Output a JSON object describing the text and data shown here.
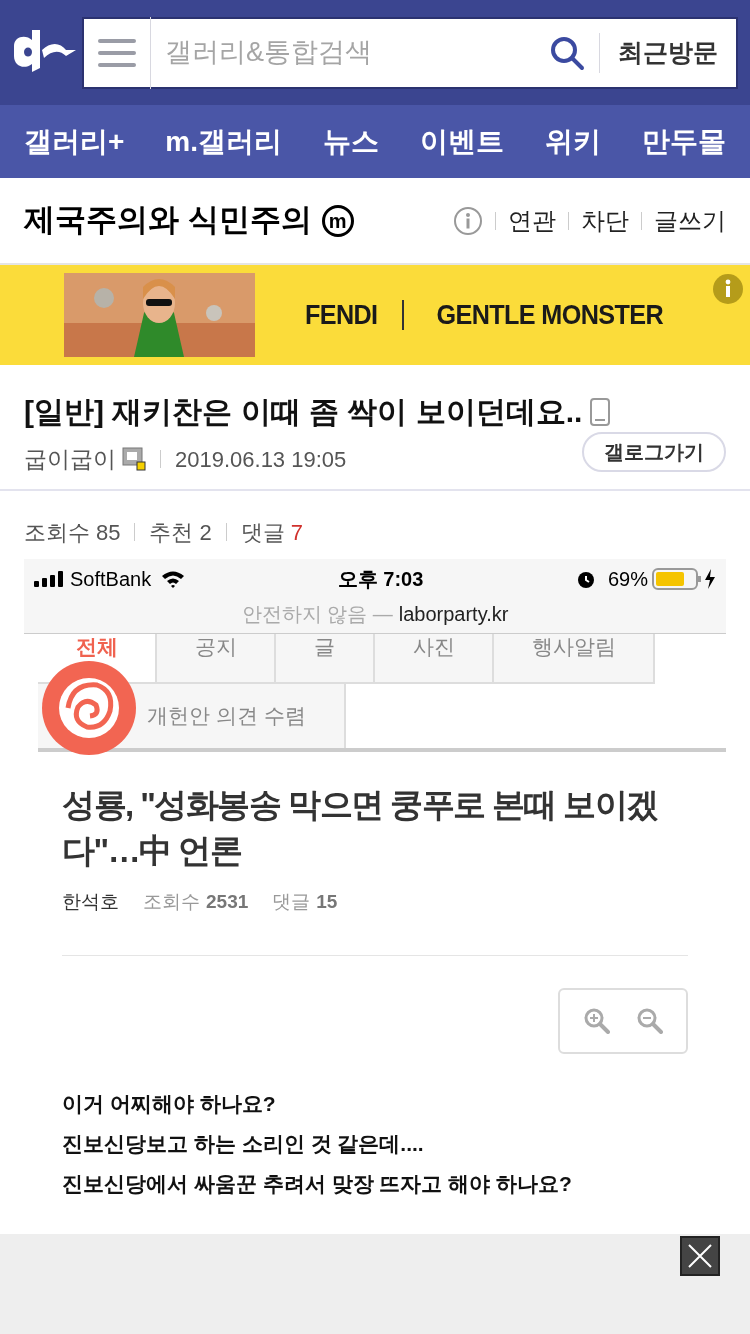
{
  "header": {
    "search": {
      "placeholder": "갤러리&통합검색"
    },
    "recent_button": "최근방문"
  },
  "nav": {
    "items": [
      {
        "label": "갤러리+"
      },
      {
        "label": "m.갤러리"
      },
      {
        "label": "뉴스"
      },
      {
        "label": "이벤트"
      },
      {
        "label": "위키"
      },
      {
        "label": "만두몰"
      }
    ]
  },
  "gallery": {
    "title": "제국주의와 식민주의",
    "badge": "m",
    "actions": [
      "연관",
      "차단",
      "글쓰기"
    ]
  },
  "ad": {
    "brands": [
      "FENDI",
      "GENTLE MONSTER"
    ]
  },
  "post": {
    "title": "[일반] 재키찬은 이때 좀 싹이 보이던데요..",
    "author": "굽이굽이",
    "date": "2019.06.13 19:05",
    "gallog_button": "갤로그가기",
    "stats": [
      {
        "label": "조회수",
        "value": "85",
        "color": "#555555"
      },
      {
        "label": "추천",
        "value": "2",
        "color": "#555555"
      },
      {
        "label": "댓글",
        "value": "7",
        "color": "#d0312d"
      }
    ]
  },
  "screenshot": {
    "status_bar": {
      "carrier": "SoftBank",
      "time": "오후 7:03",
      "battery": "69%"
    },
    "url_bar": {
      "security": "안전하지 않음 —",
      "url": "laborparty.kr"
    },
    "tabs": [
      {
        "label": "전체",
        "selected": true
      },
      {
        "label": "공지",
        "selected": false
      },
      {
        "label": "글",
        "selected": false
      },
      {
        "label": "사진",
        "selected": false
      },
      {
        "label": "행사알림",
        "selected": false
      },
      {
        "label": "개헌안 의견 수렴",
        "selected": false
      }
    ],
    "article": {
      "title": "성룡, \"성화봉송 막으면 쿵푸로 본때 보이겠다\"…中 언론",
      "author": "한석호",
      "views_label": "조회수",
      "views": "2531",
      "comments_label": "댓글",
      "comments": "15",
      "body": [
        "이거 어찌해야 하나요?",
        "진보신당보고 하는 소리인 것 같은데....",
        "진보신당에서 싸움꾼 추려서 맞장 뜨자고 해야 하나요?"
      ]
    }
  }
}
